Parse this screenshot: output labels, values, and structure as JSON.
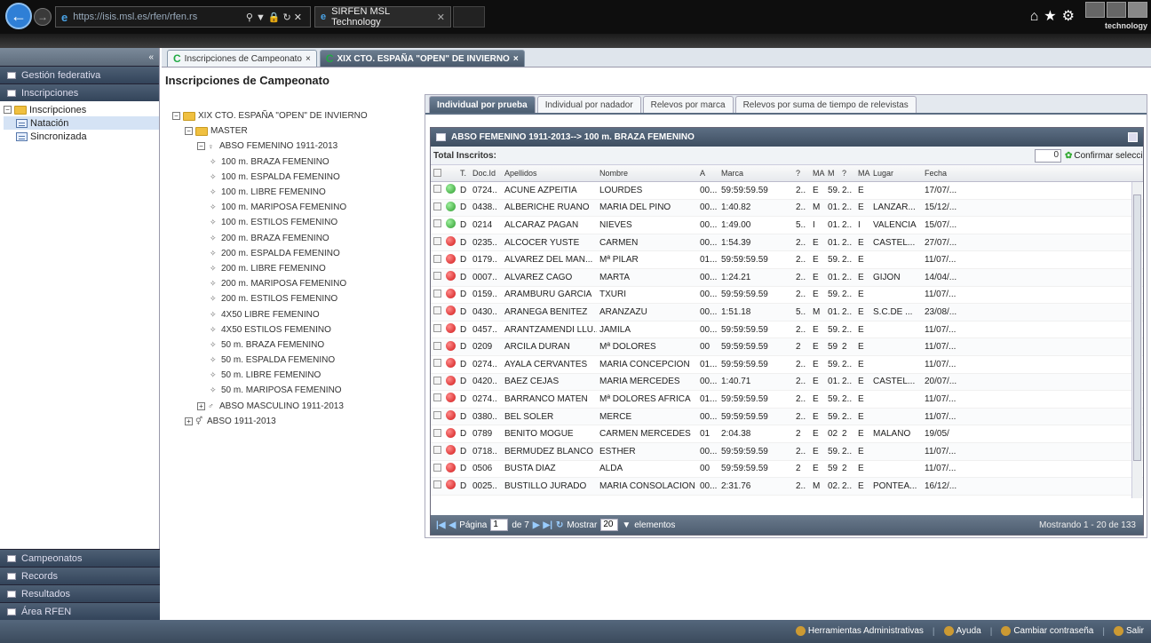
{
  "browser": {
    "url": "https://isis.msl.es/rfen/rfen.rs",
    "tab_title": "SIRFEN MSL Technology",
    "brand": "technology"
  },
  "sidebar": {
    "top_sections": [
      "Gestión federativa",
      "Inscripciones"
    ],
    "tree": [
      {
        "label": "Inscripciones",
        "level": 0,
        "type": "folder",
        "expanded": true
      },
      {
        "label": "Natación",
        "level": 1,
        "type": "doc",
        "selected": true
      },
      {
        "label": "Sincronizada",
        "level": 1,
        "type": "doc"
      }
    ],
    "bottom_sections": [
      "Campeonatos",
      "Records",
      "Resultados",
      "Área RFEN"
    ]
  },
  "main": {
    "tabs": [
      {
        "label": "Inscripciones de Campeonato",
        "active": false
      },
      {
        "label": "XIX CTO. ESPAÑA \"OPEN\" DE INVIERNO",
        "active": true
      }
    ],
    "page_title": "Inscripciones de Campeonato"
  },
  "event_tree": [
    {
      "label": "XIX CTO. ESPAÑA \"OPEN\" DE INVIERNO",
      "level": 0,
      "type": "folder"
    },
    {
      "label": "MASTER",
      "level": 1,
      "type": "folder"
    },
    {
      "label": "ABSO FEMENINO 1911-2013",
      "level": 2,
      "type": "female"
    },
    {
      "label": "100 m. BRAZA FEMENINO",
      "level": 3,
      "type": "leaf"
    },
    {
      "label": "100 m. ESPALDA FEMENINO",
      "level": 3,
      "type": "leaf"
    },
    {
      "label": "100 m. LIBRE FEMENINO",
      "level": 3,
      "type": "leaf"
    },
    {
      "label": "100 m. MARIPOSA FEMENINO",
      "level": 3,
      "type": "leaf"
    },
    {
      "label": "100 m. ESTILOS FEMENINO",
      "level": 3,
      "type": "leaf"
    },
    {
      "label": "200 m. BRAZA FEMENINO",
      "level": 3,
      "type": "leaf"
    },
    {
      "label": "200 m. ESPALDA FEMENINO",
      "level": 3,
      "type": "leaf"
    },
    {
      "label": "200 m. LIBRE FEMENINO",
      "level": 3,
      "type": "leaf"
    },
    {
      "label": "200 m. MARIPOSA FEMENINO",
      "level": 3,
      "type": "leaf"
    },
    {
      "label": "200 m. ESTILOS FEMENINO",
      "level": 3,
      "type": "leaf"
    },
    {
      "label": "4X50 LIBRE FEMENINO",
      "level": 3,
      "type": "leaf"
    },
    {
      "label": "4X50 ESTILOS FEMENINO",
      "level": 3,
      "type": "leaf"
    },
    {
      "label": "50 m. BRAZA FEMENINO",
      "level": 3,
      "type": "leaf"
    },
    {
      "label": "50 m. ESPALDA FEMENINO",
      "level": 3,
      "type": "leaf"
    },
    {
      "label": "50 m. LIBRE FEMENINO",
      "level": 3,
      "type": "leaf"
    },
    {
      "label": "50 m. MARIPOSA FEMENINO",
      "level": 3,
      "type": "leaf"
    },
    {
      "label": "ABSO MASCULINO 1911-2013",
      "level": 2,
      "type": "male"
    },
    {
      "label": "ABSO 1911-2013",
      "level": 1,
      "type": "mixed"
    }
  ],
  "subtabs": [
    "Individual por prueba",
    "Individual por nadador",
    "Relevos por marca",
    "Relevos por suma de tiempo de relevistas"
  ],
  "grid": {
    "title": "ABSO FEMENINO 1911-2013--> 100 m. BRAZA FEMENINO",
    "total_label": "Total Inscritos:",
    "count_value": "0",
    "confirm_label": "Confirmar selección",
    "columns": [
      "",
      "",
      "T.",
      "Doc.Id",
      "Apellidos",
      "Nombre",
      "A",
      "Marca",
      "?",
      "MA",
      "M",
      "?",
      "MA",
      "Lugar",
      "Fecha"
    ],
    "rows": [
      [
        "verde",
        "D",
        "0724..",
        "ACUÑE AZPEITIA",
        "LOURDES",
        "00...",
        "59:59:59.59",
        "2..",
        "E",
        "59.",
        "2..",
        "E",
        "",
        "17/07/..."
      ],
      [
        "verde",
        "D",
        "0438..",
        "ALBERICHE RUANO",
        "MARIA DEL PINO",
        "00...",
        "1:40.82",
        "2..",
        "M",
        "01.",
        "2..",
        "E",
        "LANZAR...",
        "15/12/..."
      ],
      [
        "verde",
        "D",
        "0214",
        "ALCARAZ PAGAN",
        "NIEVES",
        "00...",
        "1:49.00",
        "5..",
        "I",
        "01.",
        "2..",
        "I",
        "VALENCIA",
        "15/07/..."
      ],
      [
        "roja",
        "D",
        "0235..",
        "ALCOCER YUSTE",
        "CARMEN",
        "00...",
        "1:54.39",
        "2..",
        "E",
        "01.",
        "2..",
        "E",
        "CASTEL...",
        "27/07/..."
      ],
      [
        "roja",
        "D",
        "0179..",
        "ALVAREZ DEL MAN...",
        "Mª PILAR",
        "01...",
        "59:59:59.59",
        "2..",
        "E",
        "59.",
        "2..",
        "E",
        "",
        "11/07/..."
      ],
      [
        "roja",
        "D",
        "0007..",
        "ALVAREZ CAGO",
        "MARTA",
        "00...",
        "1:24.21",
        "2..",
        "E",
        "01.",
        "2..",
        "E",
        "GIJON",
        "14/04/..."
      ],
      [
        "roja",
        "D",
        "0159..",
        "ARAMBURU GARCIA",
        "TXURI",
        "00...",
        "59:59:59.59",
        "2..",
        "E",
        "59.",
        "2..",
        "E",
        "",
        "11/07/..."
      ],
      [
        "roja",
        "D",
        "0430..",
        "ARANEGA BENITEZ",
        "ARANZAZU",
        "00...",
        "1:51.18",
        "5..",
        "M",
        "01.",
        "2..",
        "E",
        "S.C.DE ...",
        "23/08/..."
      ],
      [
        "roja",
        "D",
        "0457..",
        "ARANTZAMENDI LLU...",
        "JAMILA",
        "00...",
        "59:59:59.59",
        "2..",
        "E",
        "59.",
        "2..",
        "E",
        "",
        "11/07/..."
      ],
      [
        "roja",
        "D",
        "0209",
        "ARCILA DURAN",
        "Mª DOLORES",
        "00",
        "59:59:59.59",
        "2",
        "E",
        "59",
        "2",
        "E",
        "",
        "11/07/..."
      ],
      [
        "roja",
        "D",
        "0274..",
        "AYALA CERVANTES",
        "MARIA CONCEPCION",
        "01...",
        "59:59:59.59",
        "2..",
        "E",
        "59.",
        "2..",
        "E",
        "",
        "11/07/..."
      ],
      [
        "roja",
        "D",
        "0420..",
        "BAEZ CEJAS",
        "MARIA MERCEDES",
        "00...",
        "1:40.71",
        "2..",
        "E",
        "01.",
        "2..",
        "E",
        "CASTEL...",
        "20/07/..."
      ],
      [
        "roja",
        "D",
        "0274..",
        "BARRANCO MATEN",
        "Mª DOLORES AFRICA",
        "01...",
        "59:59:59.59",
        "2..",
        "E",
        "59.",
        "2..",
        "E",
        "",
        "11/07/..."
      ],
      [
        "roja",
        "D",
        "0380..",
        "BEL SOLER",
        "MERCE",
        "00...",
        "59:59:59.59",
        "2..",
        "E",
        "59.",
        "2..",
        "E",
        "",
        "11/07/..."
      ],
      [
        "roja",
        "D",
        "0789",
        "BENITO MOGUE",
        "CARMEN MERCEDES",
        "01",
        "2:04.38",
        "2",
        "E",
        "02",
        "2",
        "E",
        "MALAÑO",
        "19/05/"
      ],
      [
        "roja",
        "D",
        "0718..",
        "BERMUDEZ BLANCO",
        "ESTHER",
        "00...",
        "59:59:59.59",
        "2..",
        "E",
        "59.",
        "2..",
        "E",
        "",
        "11/07/..."
      ],
      [
        "roja",
        "D",
        "0506",
        "BUSTA DÍAZ",
        "ALDA",
        "00",
        "59:59:59.59",
        "2",
        "E",
        "59",
        "2",
        "E",
        "",
        "11/07/..."
      ],
      [
        "roja",
        "D",
        "0025..",
        "BUSTILLO JURADO",
        "MARIA CONSOLACION",
        "00...",
        "2:31.76",
        "2..",
        "M",
        "02.",
        "2..",
        "E",
        "PONTEA...",
        "16/12/..."
      ]
    ]
  },
  "pager": {
    "page_label": "Página",
    "page_value": "1",
    "of_label": "de 7",
    "show_label": "Mostrar",
    "show_value": "20",
    "elements_label": "elementos",
    "summary": "Mostrando 1 - 20 de 133"
  },
  "status_bar": [
    "Herramientas Administrativas",
    "Ayuda",
    "Cambiar contraseña",
    "Salir"
  ]
}
